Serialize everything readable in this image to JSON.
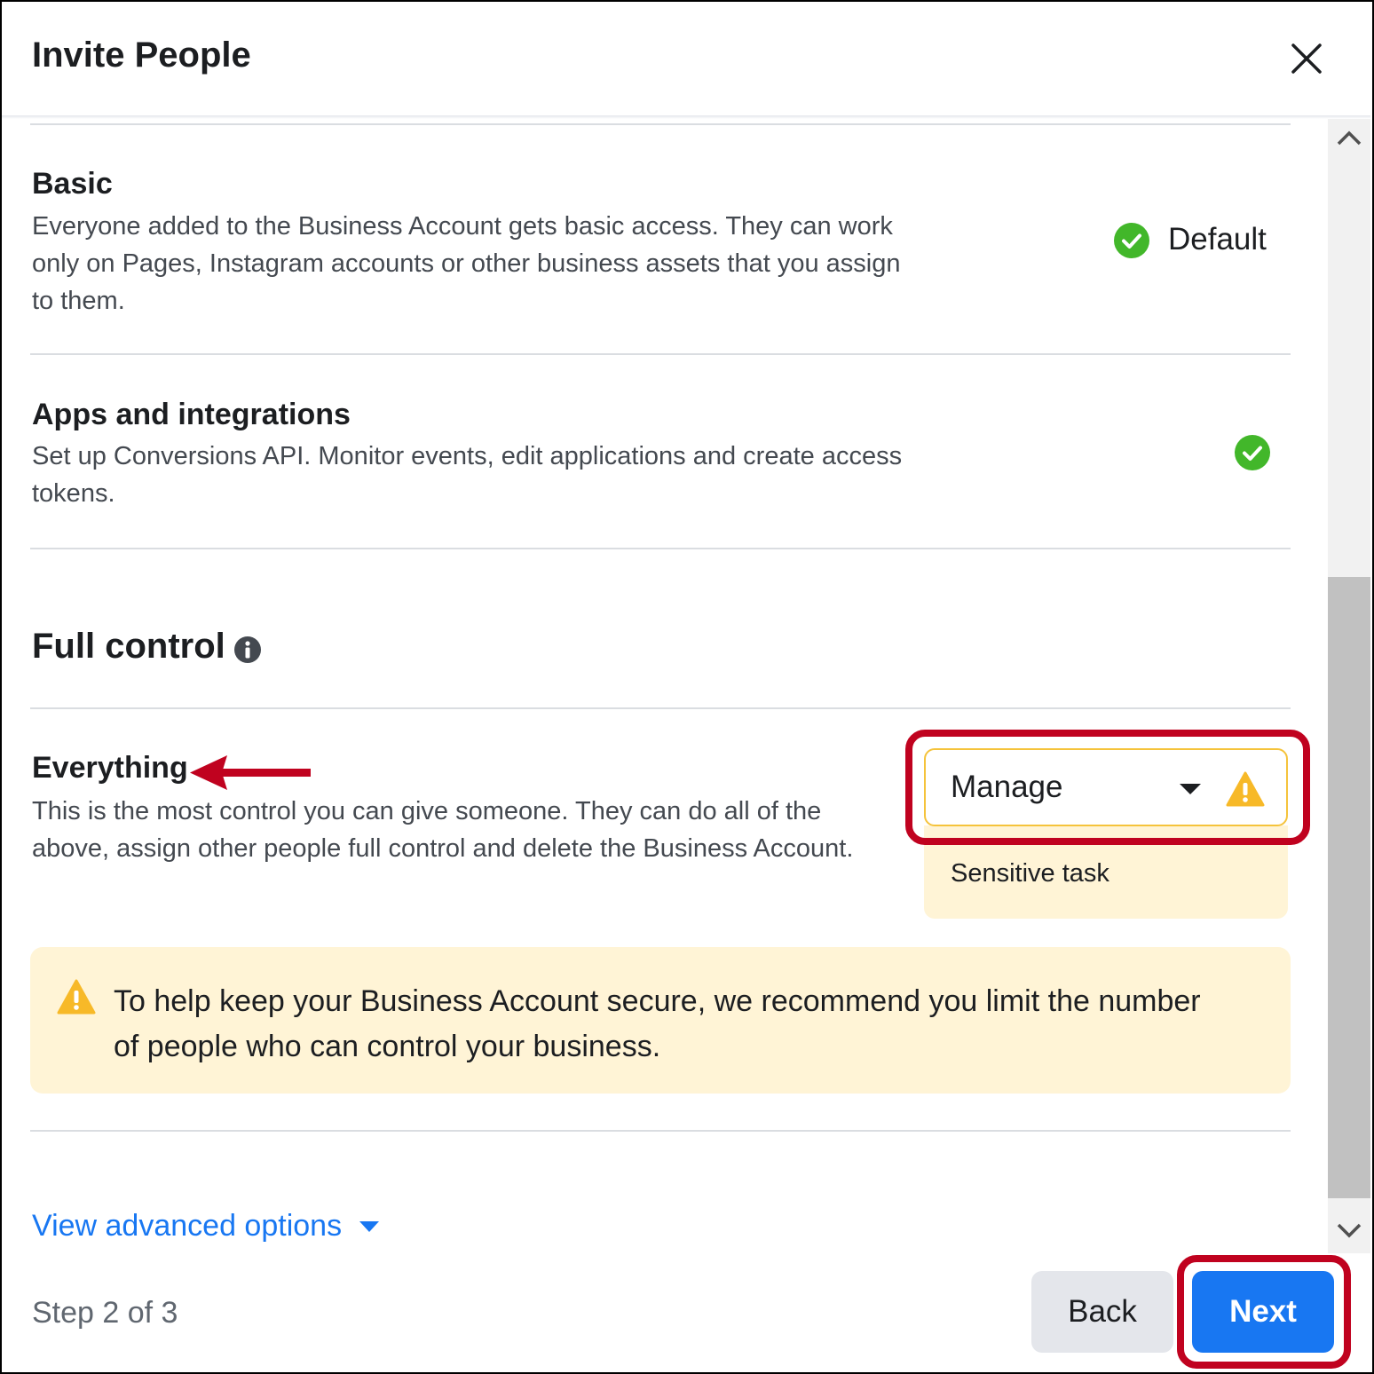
{
  "dialog": {
    "title": "Invite People",
    "close_icon": "close-icon"
  },
  "sections": {
    "basic": {
      "title": "Basic",
      "description": "Everyone added to the Business Account gets basic access. They can work only on Pages, Instagram accounts or other business assets that you assign to them.",
      "status_label": "Default",
      "status_icon": "check-circle-icon"
    },
    "apps": {
      "title": "Apps and integrations",
      "description": "Set up Conversions API. Monitor events, edit applications and create access tokens.",
      "status_icon": "check-circle-icon"
    },
    "full_control": {
      "title": "Full control",
      "info_icon": "info-icon"
    },
    "everything": {
      "title": "Everything",
      "description": "This is the most control you can give someone. They can do all of the above, assign other people full control and delete the Business Account.",
      "select_value": "Manage",
      "sensitive_label": "Sensitive task"
    }
  },
  "alert": {
    "text": "To help keep your Business Account secure, we recommend you limit the number of people who can control your business."
  },
  "footer": {
    "advanced_link": "View advanced options",
    "step_text": "Step 2 of 3",
    "back_label": "Back",
    "next_label": "Next"
  },
  "colors": {
    "accent": "#1877f2",
    "success": "#42b72a",
    "warning": "#f7b928",
    "highlight": "#c0021f",
    "alert_bg": "#fff4d6"
  }
}
